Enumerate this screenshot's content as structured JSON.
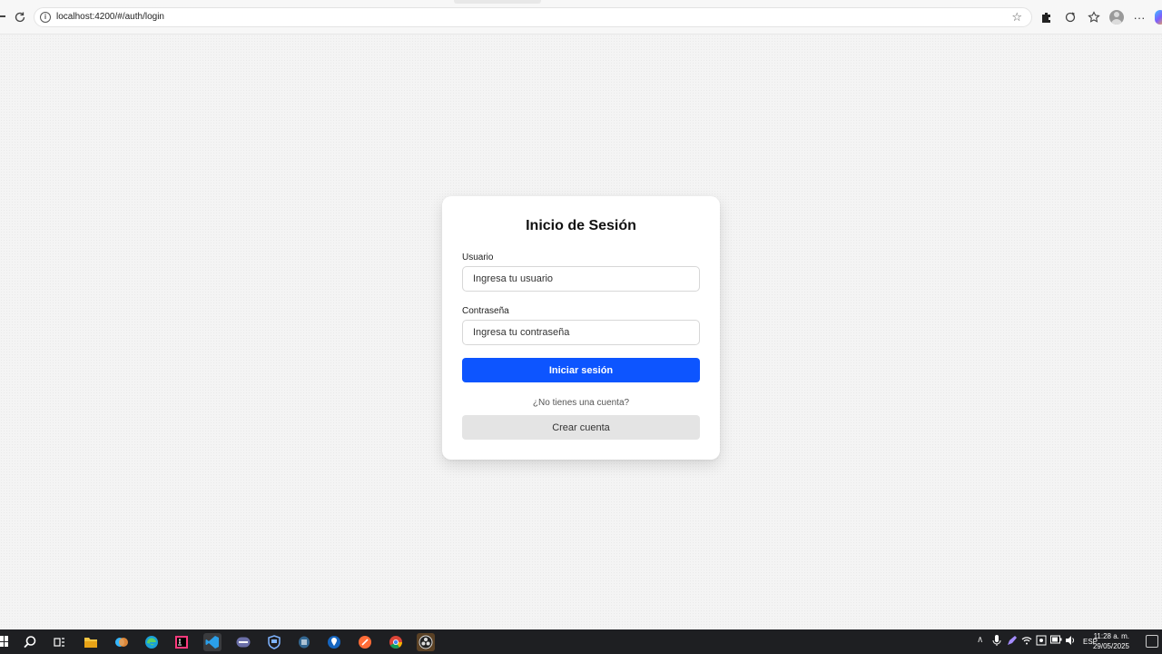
{
  "browser": {
    "url": "localhost:4200/#/auth/login"
  },
  "login": {
    "title": "Inicio de Sesión",
    "username_label": "Usuario",
    "username_placeholder": "Ingresa tu usuario",
    "password_label": "Contraseña",
    "password_placeholder": "Ingresa tu contraseña",
    "submit_label": "Iniciar sesión",
    "no_account_text": "¿No tienes una cuenta?",
    "create_account_label": "Crear cuenta"
  },
  "taskbar": {
    "language": "ESP",
    "time": "11:28 a. m.",
    "date": "29/05/2025"
  },
  "colors": {
    "primary": "#0d55ff",
    "secondary_button": "#e4e4e4",
    "taskbar": "#1e1f22"
  },
  "icons": [
    "reload-icon",
    "info-icon",
    "star-icon",
    "extension-icon",
    "refresh-icon",
    "favorites-icon",
    "profile-icon",
    "more-icon",
    "copilot-icon"
  ]
}
